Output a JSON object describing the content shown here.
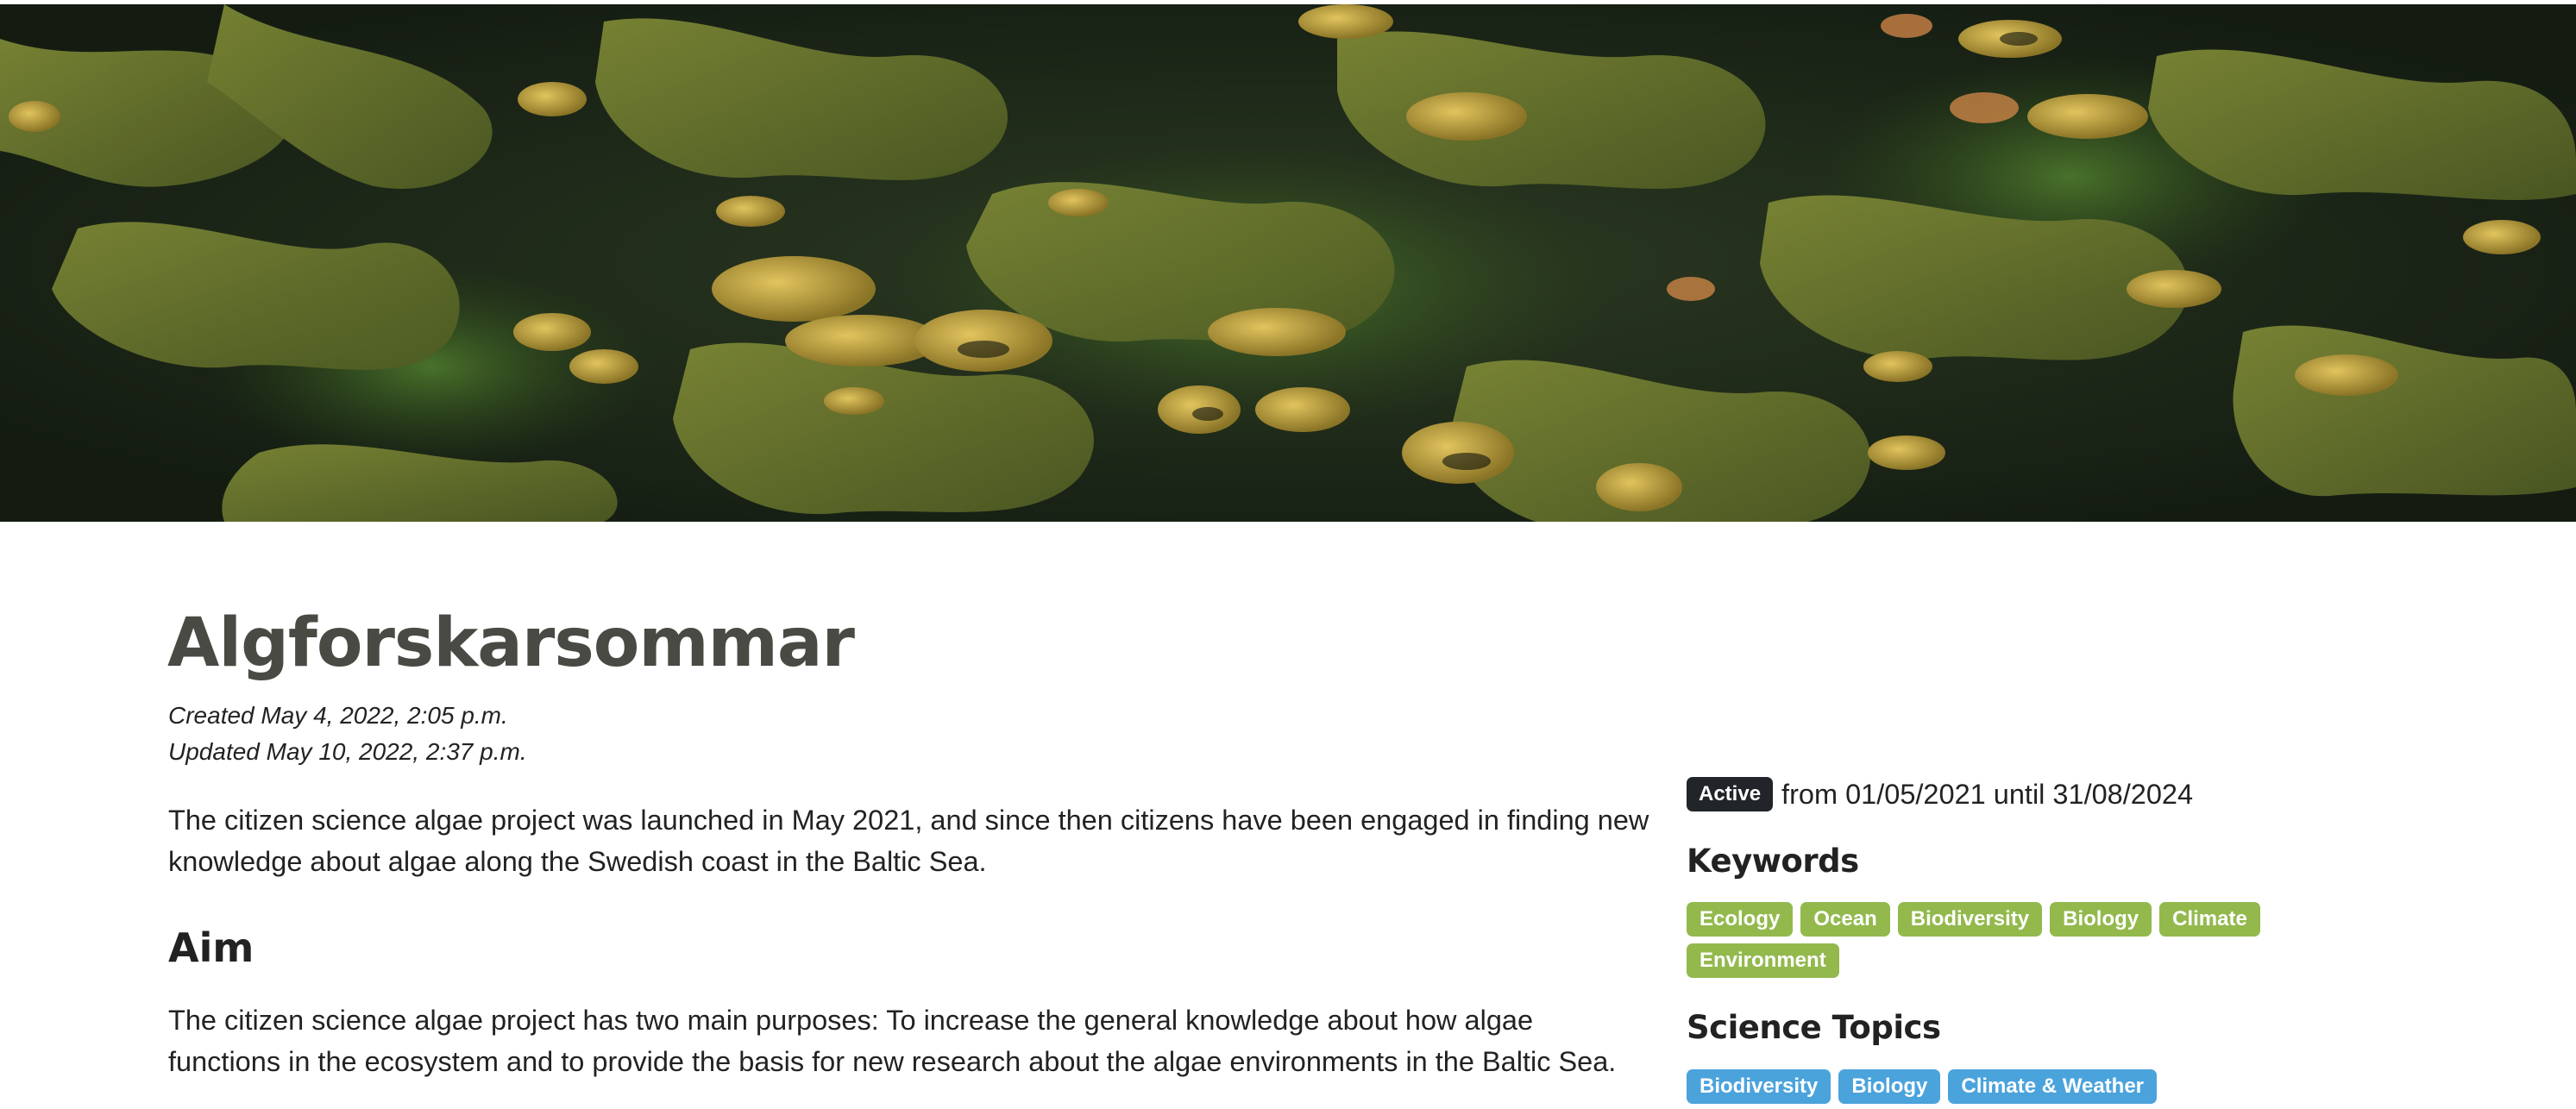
{
  "hero": {
    "image_subject": "underwater bladderwrack seaweed",
    "colors": {
      "background": "#1c2618",
      "frond": "#6d7a2c",
      "bladder": "#c2a640",
      "highlight": "#d6b34d",
      "green": "#3f6a24"
    }
  },
  "project": {
    "title": "Algforskarsommar",
    "created": "Created May 4, 2022, 2:05 p.m.",
    "updated": "Updated May 10, 2022, 2:37 p.m.",
    "intro": "The citizen science algae project was launched in May 2021, and since then citizens have been engaged in finding new knowledge about algae along the Swedish coast in the Baltic Sea.",
    "aim_heading": "Aim",
    "aim_text": "The citizen science algae project has two main purposes: To increase the general knowledge about how algae functions in the ecosystem and to provide the basis for new research about the algae environments in the Baltic Sea."
  },
  "sidebar": {
    "status_badge": "Active",
    "status_period": "from 01/05/2021 until 31/08/2024",
    "keywords_heading": "Keywords",
    "keywords": [
      "Ecology",
      "Ocean",
      "Biodiversity",
      "Biology",
      "Climate",
      "Environment"
    ],
    "topics_heading": "Science Topics",
    "topics": [
      "Biodiversity",
      "Biology",
      "Climate & Weather"
    ]
  },
  "colors": {
    "keyword_tag": "#93b94d",
    "topic_tag": "#4ba3dc",
    "status_badge": "#212529",
    "title": "#4a4a44"
  }
}
